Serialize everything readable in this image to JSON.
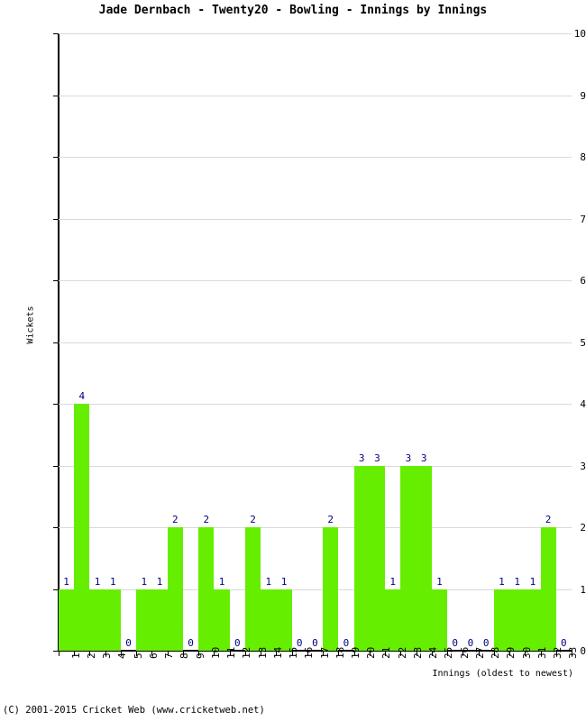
{
  "chart_data": {
    "type": "bar",
    "title": "Jade Dernbach - Twenty20 - Bowling - Innings by Innings",
    "xlabel": "Innings (oldest to newest)",
    "ylabel": "Wickets",
    "categories": [
      "1",
      "2",
      "3",
      "4",
      "5",
      "6",
      "7",
      "8",
      "9",
      "10",
      "11",
      "12",
      "13",
      "14",
      "15",
      "16",
      "17",
      "18",
      "19",
      "20",
      "21",
      "22",
      "23",
      "24",
      "25",
      "26",
      "27",
      "28",
      "29",
      "30",
      "31",
      "32",
      "33"
    ],
    "values": [
      1,
      4,
      1,
      1,
      0,
      1,
      1,
      2,
      0,
      2,
      1,
      0,
      2,
      1,
      1,
      0,
      0,
      2,
      0,
      3,
      3,
      1,
      3,
      3,
      1,
      0,
      0,
      0,
      1,
      1,
      1,
      2,
      0
    ],
    "ylim": [
      0,
      10
    ],
    "yticks": [
      "0",
      "1",
      "2",
      "3",
      "4",
      "5",
      "6",
      "7",
      "8",
      "9",
      "10"
    ],
    "grid": true,
    "legend": null,
    "bar_color": "#66ee00",
    "value_label_color": "#000080",
    "grid_color": "#d9d9d9"
  },
  "footer": {
    "copyright": "(C) 2001-2015 Cricket Web (www.cricketweb.net)"
  }
}
